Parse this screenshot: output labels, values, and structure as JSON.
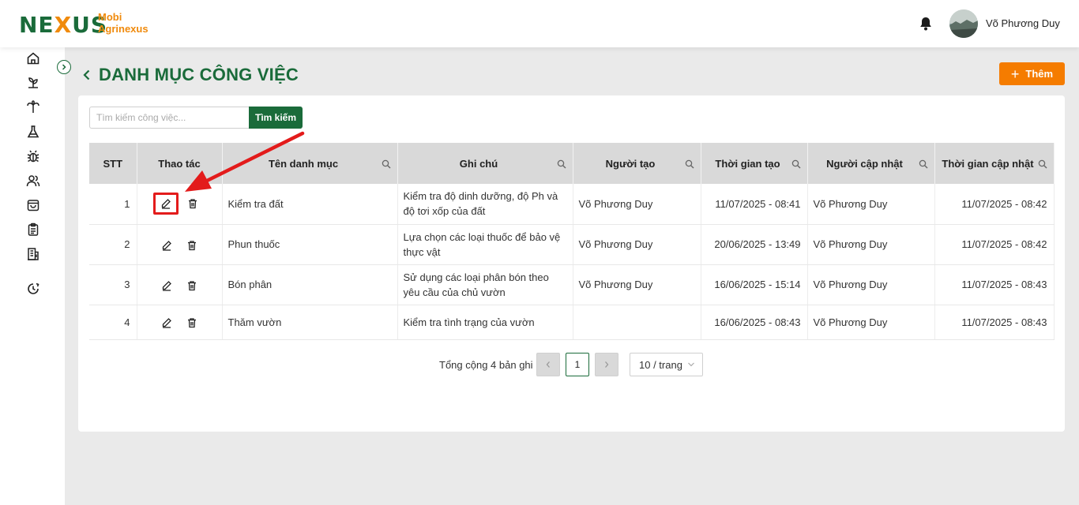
{
  "header": {
    "logo_text": "NEXUS",
    "brand_line1": "Mobi",
    "brand_line2": "Agrinexus",
    "user_name": "Võ Phương Duy"
  },
  "sidebar": {
    "icons": [
      "home-icon",
      "sprout-icon",
      "plant-icon",
      "flask-icon",
      "bug-icon",
      "users-icon",
      "bag-icon",
      "clipboard-icon",
      "building-icon",
      "history-icon"
    ]
  },
  "page": {
    "title": "DANH MỤC CÔNG VIỆC",
    "add_label": "Thêm"
  },
  "search": {
    "placeholder": "Tìm kiếm công việc...",
    "button_label": "Tìm kiếm"
  },
  "table": {
    "columns": [
      "STT",
      "Thao tác",
      "Tên danh mục",
      "Ghi chú",
      "Người tạo",
      "Thời gian tạo",
      "Người cập nhật",
      "Thời gian cập nhật"
    ],
    "rows": [
      {
        "stt": "1",
        "name": "Kiểm tra đất",
        "note": "Kiểm tra độ dinh dưỡng, độ Ph và độ tơi xốp của đất",
        "creator": "Võ Phương Duy",
        "created": "11/07/2025 - 08:41",
        "updater": "Võ Phương Duy",
        "updated": "11/07/2025 - 08:42"
      },
      {
        "stt": "2",
        "name": "Phun thuốc",
        "note": "Lựa chọn các loại thuốc để bảo vệ thực vật",
        "creator": "Võ Phương Duy",
        "created": "20/06/2025 - 13:49",
        "updater": "Võ Phương Duy",
        "updated": "11/07/2025 - 08:42"
      },
      {
        "stt": "3",
        "name": "Bón phân",
        "note": "Sử dụng các loại phân bón theo yêu cầu của chủ vườn",
        "creator": "Võ Phương Duy",
        "created": "16/06/2025 - 15:14",
        "updater": "Võ Phương Duy",
        "updated": "11/07/2025 - 08:43"
      },
      {
        "stt": "4",
        "name": "Thăm vườn",
        "note": "Kiểm tra tình trạng của vườn",
        "creator": "",
        "created": "16/06/2025 - 08:43",
        "updater": "Võ Phương Duy",
        "updated": "11/07/2025 - 08:43"
      }
    ]
  },
  "pagination": {
    "total_label": "Tổng cộng 4 bản ghi",
    "current_page": "1",
    "page_size": "10 / trang"
  },
  "colors": {
    "brand_green": "#1a6b3a",
    "accent_orange": "#f57c00",
    "highlight_red": "#e31b1b"
  }
}
